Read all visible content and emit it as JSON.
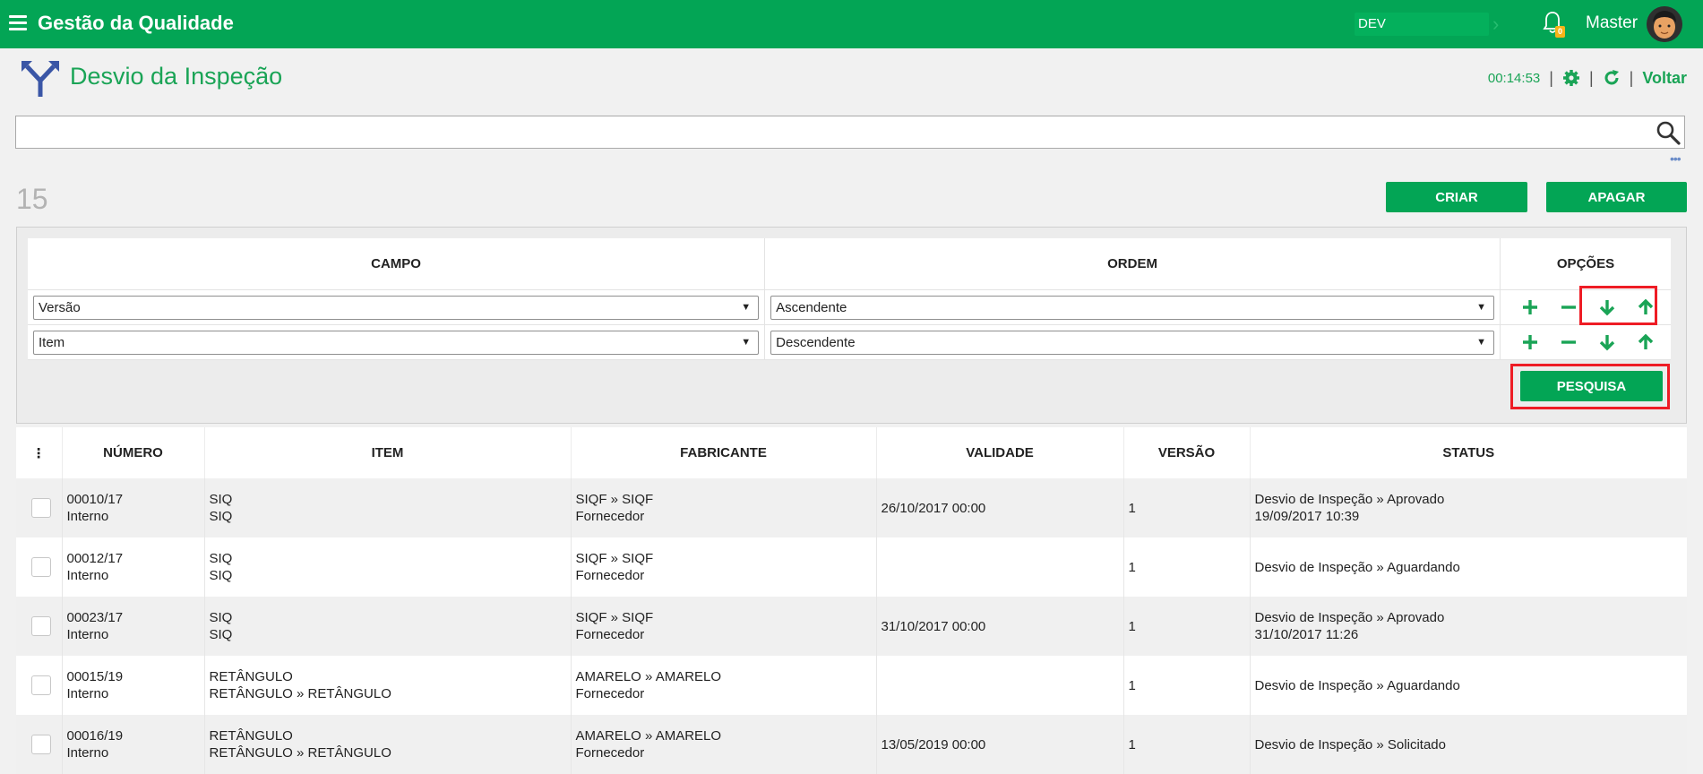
{
  "app": {
    "title": "Gestão da Qualidade"
  },
  "topbar": {
    "env": "DEV",
    "user": "Master",
    "notifications": "0"
  },
  "page": {
    "title": "Desvio da Inspeção",
    "timer": "00:14:53",
    "back_label": "Voltar"
  },
  "search": {
    "placeholder": ""
  },
  "count": "15",
  "buttons": {
    "create": "CRIAR",
    "delete": "APAGAR",
    "search": "PESQUISA"
  },
  "sort": {
    "headers": {
      "field": "CAMPO",
      "order": "ORDEM",
      "options": "OPÇÕES"
    },
    "rows": [
      {
        "field": "Versão",
        "order": "Ascendente"
      },
      {
        "field": "Item",
        "order": "Descendente"
      }
    ]
  },
  "table": {
    "headers": {
      "menu": "⋮",
      "numero": "NÚMERO",
      "item": "ITEM",
      "fabricante": "FABRICANTE",
      "validade": "VALIDADE",
      "versao": "VERSÃO",
      "status": "STATUS"
    },
    "rows": [
      {
        "numero": "00010/17",
        "origem": "Interno",
        "item1": "SIQ",
        "item2": "SIQ",
        "fab1": "SIQF » SIQF",
        "fab2": "Fornecedor",
        "validade": "26/10/2017 00:00",
        "versao": "1",
        "status1": "Desvio de Inspeção » Aprovado",
        "status2": "19/09/2017 10:39"
      },
      {
        "numero": "00012/17",
        "origem": "Interno",
        "item1": "SIQ",
        "item2": "SIQ",
        "fab1": "SIQF » SIQF",
        "fab2": "Fornecedor",
        "validade": "",
        "versao": "1",
        "status1": "Desvio de Inspeção » Aguardando",
        "status2": ""
      },
      {
        "numero": "00023/17",
        "origem": "Interno",
        "item1": "SIQ",
        "item2": "SIQ",
        "fab1": "SIQF » SIQF",
        "fab2": "Fornecedor",
        "validade": "31/10/2017 00:00",
        "versao": "1",
        "status1": "Desvio de Inspeção » Aprovado",
        "status2": "31/10/2017 11:26"
      },
      {
        "numero": "00015/19",
        "origem": "Interno",
        "item1": "RETÂNGULO",
        "item2": "RETÂNGULO » RETÂNGULO",
        "fab1": "AMARELO » AMARELO",
        "fab2": "Fornecedor",
        "validade": "",
        "versao": "1",
        "status1": "Desvio de Inspeção » Aguardando",
        "status2": ""
      },
      {
        "numero": "00016/19",
        "origem": "Interno",
        "item1": "RETÂNGULO",
        "item2": "RETÂNGULO » RETÂNGULO",
        "fab1": "AMARELO » AMARELO",
        "fab2": "Fornecedor",
        "validade": "13/05/2019 00:00",
        "versao": "1",
        "status1": "Desvio de Inspeção » Solicitado",
        "status2": ""
      }
    ]
  },
  "colors": {
    "brand": "#03a555",
    "highlight": "#ee1c25",
    "title": "#1aa456"
  },
  "icons": {
    "menu": "hamburger-icon",
    "bell": "bell-icon",
    "settings": "gear-icon",
    "refresh": "refresh-icon",
    "search": "search-icon",
    "page": "fork-arrows-icon"
  }
}
